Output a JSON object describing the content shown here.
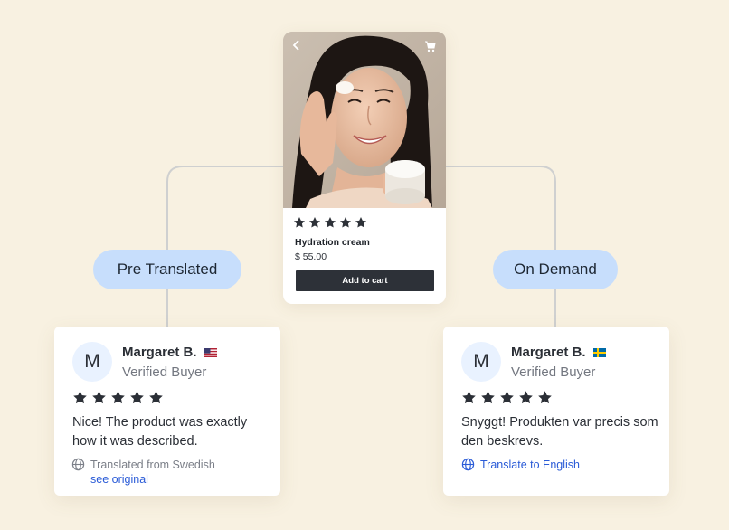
{
  "product": {
    "image_description": "woman-applying-cream-photo",
    "rating_stars": 5,
    "name": "Hydration cream",
    "price": "$ 55.00",
    "add_to_cart": "Add to cart",
    "back_icon": "chevron-left-icon",
    "cart_icon": "cart-icon"
  },
  "branches": {
    "left_label": "Pre Translated",
    "right_label": "On Demand"
  },
  "reviews": [
    {
      "initial": "M",
      "name": "Margaret B.",
      "flag": "us-flag",
      "badge": "Verified Buyer",
      "stars": 5,
      "text": "Nice! The product was exactly how it was described.",
      "note": "Translated from Swedish",
      "link": "see original"
    },
    {
      "initial": "M",
      "name": "Margaret B.",
      "flag": "sweden-flag",
      "badge": "Verified Buyer",
      "stars": 5,
      "text": "Snyggt! Produkten var precis som den beskrevs.",
      "link": "Translate to English"
    }
  ],
  "colors": {
    "background": "#f8f1e1",
    "pill": "#c7defc",
    "button": "#2d3138",
    "link": "#2a5bd7"
  }
}
